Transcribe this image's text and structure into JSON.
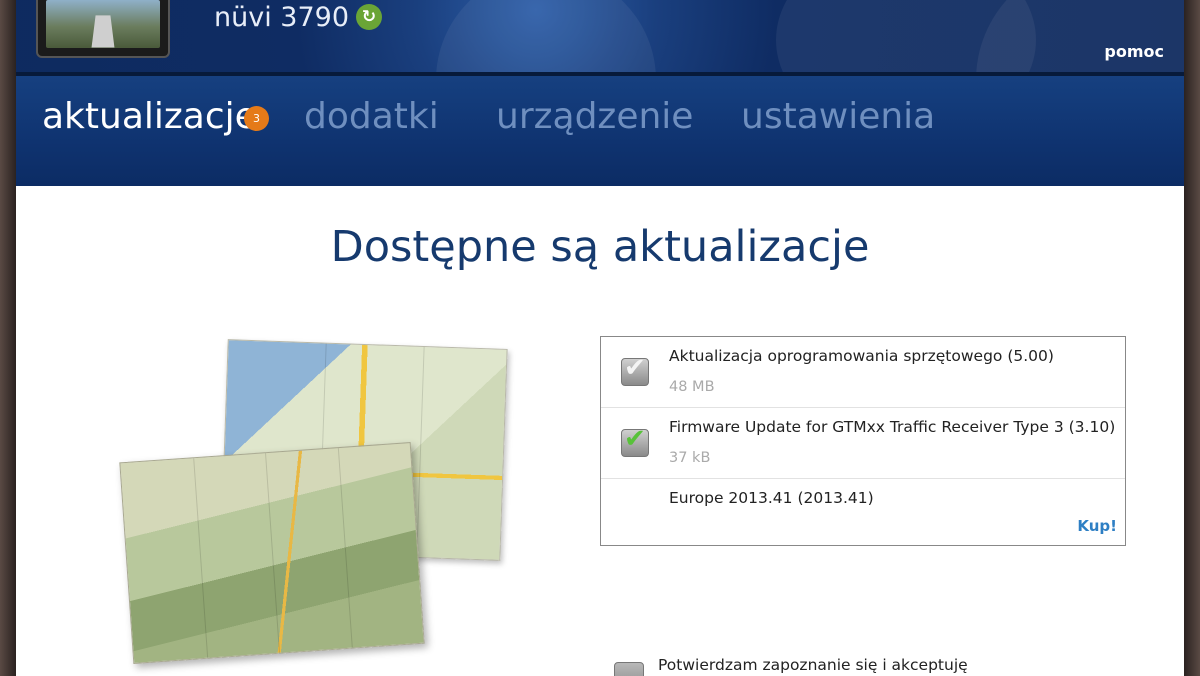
{
  "header": {
    "device_name": "nüvi 3790",
    "help_label": "pomoc",
    "sync_icon": "sync-icon"
  },
  "nav": {
    "tabs": [
      {
        "label": "aktualizacje",
        "active": true,
        "badge": "3"
      },
      {
        "label": "dodatki",
        "active": false
      },
      {
        "label": "urządzenie",
        "active": false
      },
      {
        "label": "ustawienia",
        "active": false
      }
    ]
  },
  "main": {
    "title": "Dostępne są aktualizacje",
    "updates": [
      {
        "title": "Aktualizacja oprogramowania sprzętowego (5.00)",
        "size": "48 MB",
        "checked": true,
        "check_color": "gray"
      },
      {
        "title": "Firmware Update for GTMxx Traffic Receiver Type 3 (3.10)",
        "size": "37 kB",
        "checked": true,
        "check_color": "green"
      },
      {
        "title": "Europe 2013.41 (2013.41)",
        "action": "Kup!"
      }
    ],
    "agreement_text": "Potwierdzam zapoznanie się i akceptuję"
  },
  "colors": {
    "header_bg": "#0f2c63",
    "nav_bg": "#0f3370",
    "badge": "#e57a18",
    "title": "#163a6e",
    "link": "#2e7fc4",
    "check_green": "#58c23a"
  }
}
